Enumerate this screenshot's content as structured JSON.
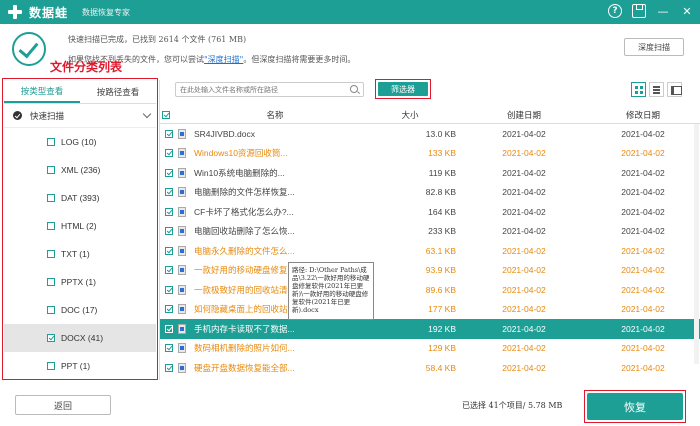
{
  "titlebar": {
    "logo": "数据蛙",
    "subtitle": "数据恢复专家",
    "help_icon": "?"
  },
  "status": {
    "line1": "快速扫描已完成，已找到 2614 个文件 (761 MB)",
    "line2_before": "如果您找不到丢失的文件，您可以尝试",
    "line2_link": "\"深度扫描\"",
    "line2_after": "。但深度扫描将需要更多时间。",
    "deep_scan_button": "深度扫描"
  },
  "annotation": "文件分类列表",
  "sidebar": {
    "tabs": [
      "按类型查看",
      "按路径查看"
    ],
    "active_tab": 0,
    "quick_scan_label": "快速扫描",
    "items": [
      {
        "label": "LOG (10)",
        "checked": false
      },
      {
        "label": "XML (236)",
        "checked": false
      },
      {
        "label": "DAT (393)",
        "checked": false
      },
      {
        "label": "HTML (2)",
        "checked": false
      },
      {
        "label": "TXT (1)",
        "checked": false
      },
      {
        "label": "PPTX (1)",
        "checked": false
      },
      {
        "label": "DOC (17)",
        "checked": false
      },
      {
        "label": "DOCX (41)",
        "checked": true
      },
      {
        "label": "PPT (1)",
        "checked": false
      }
    ]
  },
  "toolbar": {
    "search_placeholder": "在此处输入文件名称或所在路径",
    "filter_button": "筛选器"
  },
  "table": {
    "headers": {
      "name": "名称",
      "size": "大小",
      "created": "创建日期",
      "modified": "修改日期"
    },
    "rows": [
      {
        "name": "SR4JIVBD.docx",
        "size": "13.0 KB",
        "created": "2021-04-02",
        "modified": "2021-04-02",
        "style": "normal"
      },
      {
        "name": "Windows10资源回收筒...",
        "size": "133 KB",
        "created": "2021-04-02",
        "modified": "2021-04-02",
        "style": "orange"
      },
      {
        "name": "Win10系统电脑删除的...",
        "size": "119 KB",
        "created": "2021-04-02",
        "modified": "2021-04-02",
        "style": "normal"
      },
      {
        "name": "电脑删除的文件怎样恢复...",
        "size": "82.8 KB",
        "created": "2021-04-02",
        "modified": "2021-04-02",
        "style": "normal"
      },
      {
        "name": "CF卡坏了格式化怎么办?...",
        "size": "164 KB",
        "created": "2021-04-02",
        "modified": "2021-04-02",
        "style": "normal"
      },
      {
        "name": "电脑回收站删除了怎么恢...",
        "size": "233 KB",
        "created": "2021-04-02",
        "modified": "2021-04-02",
        "style": "normal"
      },
      {
        "name": "电脑永久删除的文件怎么...",
        "size": "63.1 KB",
        "created": "2021-04-02",
        "modified": "2021-04-02",
        "style": "orange"
      },
      {
        "name": "一款好用的移动硬盘修复...",
        "size": "93.9 KB",
        "created": "2021-04-02",
        "modified": "2021-04-02",
        "style": "orange"
      },
      {
        "name": "一款极致好用的回收站清...",
        "size": "89.6 KB",
        "created": "2021-04-02",
        "modified": "2021-04-02",
        "style": "orange"
      },
      {
        "name": "如何隐藏桌面上的回收站...",
        "size": "177 KB",
        "created": "2021-04-02",
        "modified": "2021-04-02",
        "style": "orange"
      },
      {
        "name": "手机内存卡读取不了数据...",
        "size": "192 KB",
        "created": "2021-04-02",
        "modified": "2021-04-02",
        "style": "selected"
      },
      {
        "name": "数码相机删除的照片如何...",
        "size": "129 KB",
        "created": "2021-04-02",
        "modified": "2021-04-02",
        "style": "orange"
      },
      {
        "name": "硬盘开盘数据恢复能全部...",
        "size": "58.4 KB",
        "created": "2021-04-02",
        "modified": "2021-04-02",
        "style": "orange"
      },
      {
        "name": "行车记录仪删除的视频恢...",
        "size": "124 KB",
        "created": "2021-04-02",
        "modified": "2021-04-02",
        "style": "orange"
      }
    ]
  },
  "tooltip": "路径: D:\\Other Paths\\成品\\3.22\\一款好用的移动硬盘修复软件(2021年已更新)\\一款好用的移动硬盘修复软件(2021年已更新).docx",
  "bottom": {
    "back_button": "返回",
    "selection_info": "已选择 41个项目/ 5.78 MB",
    "recover_button": "恢复"
  },
  "colors": {
    "accent": "#1e9f95",
    "annotation_red": "#e0192c",
    "orange_text": "#e8890c"
  }
}
